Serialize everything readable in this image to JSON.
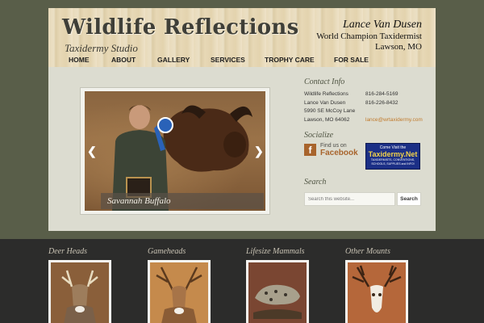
{
  "header": {
    "title": "Wildlife Reflections",
    "subtitle": "Taxidermy Studio",
    "owner": "Lance Van Dusen",
    "tagline_1": "World Champion Taxidermist",
    "tagline_2": "Lawson, MO"
  },
  "nav": {
    "items": [
      "HOME",
      "ABOUT",
      "GALLERY",
      "SERVICES",
      "TROPHY CARE",
      "FOR SALE"
    ]
  },
  "slider": {
    "caption": "Savannah Buffalo",
    "prev_icon": "chevron-left-icon",
    "next_icon": "chevron-right-icon",
    "prev_glyph": "❮",
    "next_glyph": "❯"
  },
  "contact": {
    "heading": "Contact Info",
    "name_line": "Wildlife Reflections",
    "person": "Lance Van Dusen",
    "street": "5990 SE McCoy Lane",
    "city": "Lawson, MO 64062",
    "phone_1": "816-284-5169",
    "phone_2": "816-226-8432",
    "email": "lance@wrtaxidermy.com"
  },
  "socialize": {
    "heading": "Socialize",
    "fb_line1": "Find us on",
    "fb_line2": "Facebook",
    "fb_glyph": "f",
    "tnet_line1": "Come Visit the",
    "tnet_line2": "Taxidermy.Net",
    "tnet_line3": "TAXIDERMISTS, CONVENTIONS,",
    "tnet_line4": "SCHOOLS, SUPPLIES and INFO!"
  },
  "search": {
    "heading": "Search",
    "placeholder": "Search this website...",
    "button": "Search"
  },
  "gallery": {
    "items": [
      {
        "title": "Deer Heads"
      },
      {
        "title": "Gameheads"
      },
      {
        "title": "Lifesize Mammals"
      },
      {
        "title": "Other Mounts"
      }
    ]
  },
  "colors": {
    "page_bg": "#595e49",
    "content_bg": "#dcdcd0",
    "bottom_bg": "#2c2c2b",
    "accent": "#c17a2c",
    "heading": "#4f5442"
  }
}
